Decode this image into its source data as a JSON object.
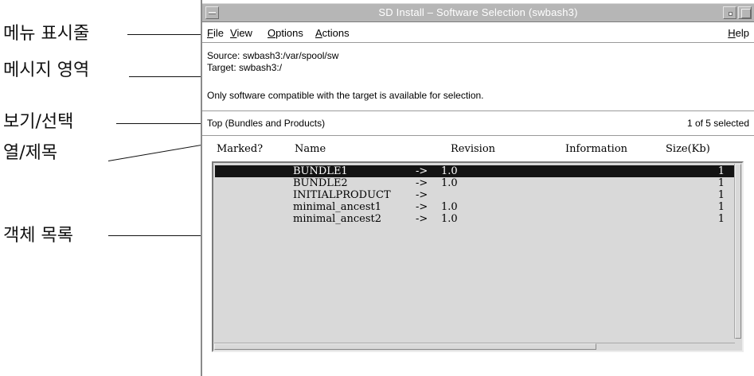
{
  "callouts": [
    {
      "label": "메뉴 표시줄"
    },
    {
      "label": "메시지 영역"
    },
    {
      "label": "보기/선택"
    },
    {
      "label": "열/제목"
    },
    {
      "label": "객체 목록"
    }
  ],
  "window": {
    "title": "SD Install – Software Selection (swbash3)",
    "title_icon": "window-menu-icon",
    "min_icon": "minimize-icon",
    "max_icon": "maximize-icon"
  },
  "menubar": {
    "file": {
      "mnemonic": "F",
      "rest": "ile"
    },
    "view": {
      "mnemonic": "V",
      "rest": "iew"
    },
    "options": {
      "mnemonic": "O",
      "rest": "ptions"
    },
    "actions": {
      "mnemonic": "A",
      "rest": "ctions"
    },
    "help": {
      "mnemonic": "H",
      "rest": "elp"
    }
  },
  "message_area": {
    "source": "Source: swbash3:/var/spool/sw",
    "target": "Target:  swbash3:/",
    "note": "Only software compatible with the target is available for selection."
  },
  "view_bar": {
    "title": "Top (Bundles and Products)",
    "selection_count": "1 of 5 selected"
  },
  "columns": {
    "marked": "Marked?",
    "name": "Name",
    "revision": "Revision",
    "information": "Information",
    "size": "Size(Kb)"
  },
  "rows": [
    {
      "marked": "",
      "name": "BUNDLE1",
      "arrow": "->",
      "revision": "1.0",
      "information": "",
      "size": "1",
      "selected": true
    },
    {
      "marked": "",
      "name": "BUNDLE2",
      "arrow": "->",
      "revision": "1.0",
      "information": "",
      "size": "1",
      "selected": false
    },
    {
      "marked": "",
      "name": "INITIALPRODUCT",
      "arrow": "->",
      "revision": "",
      "information": "",
      "size": "1",
      "selected": false
    },
    {
      "marked": "",
      "name": "minimal_ancest1",
      "arrow": "->",
      "revision": "1.0",
      "information": "",
      "size": "1",
      "selected": false
    },
    {
      "marked": "",
      "name": "minimal_ancest2",
      "arrow": "->",
      "revision": "1.0",
      "information": "",
      "size": "1",
      "selected": false
    }
  ],
  "colors": {
    "titlebar": "#b6b6b6",
    "list_background": "#d9d9d9",
    "selected_row": "#141414",
    "selected_text": "#ffffff"
  }
}
